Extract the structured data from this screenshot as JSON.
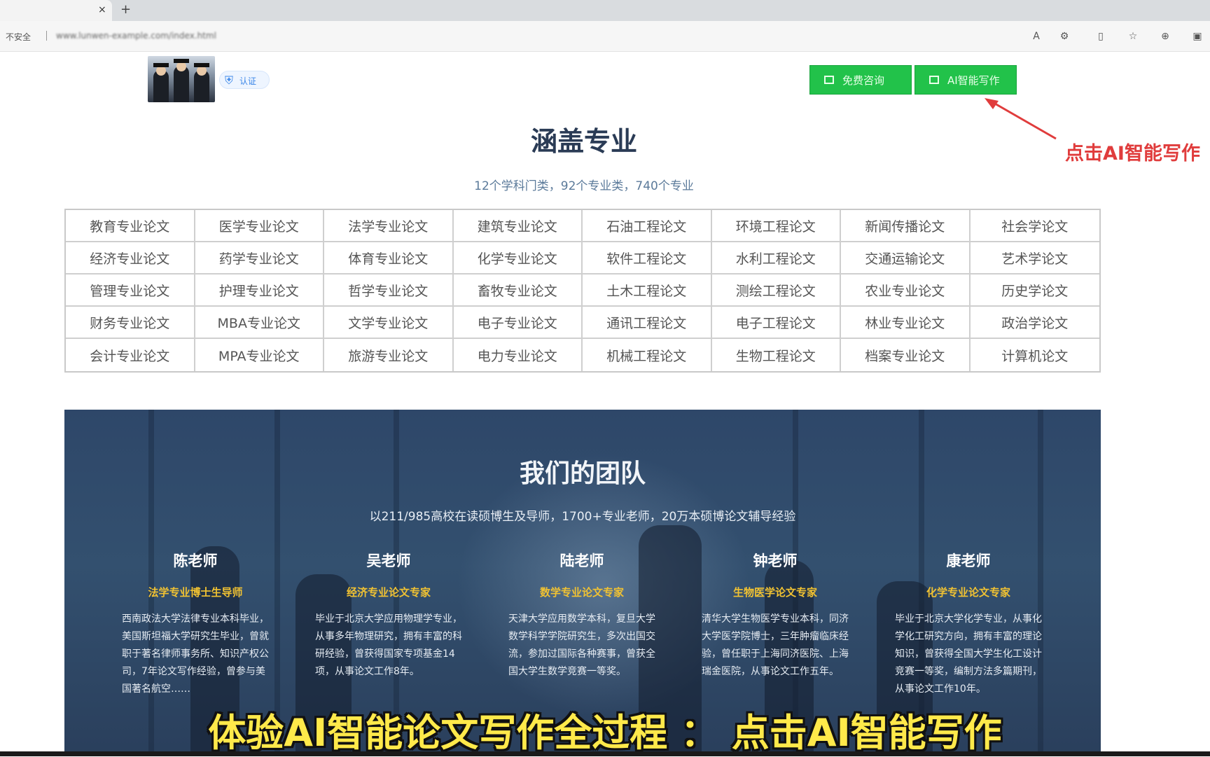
{
  "browser": {
    "tab_close": "×",
    "tab_new": "+",
    "secure_label": "不安全",
    "url": "www.lunwen-example.com/index.html"
  },
  "header": {
    "badge_text": "认证",
    "btn_free": "免费咨询",
    "btn_ai": "AI智能写作"
  },
  "annotation": {
    "text": "点击AI智能写作",
    "color": "#e03c3c"
  },
  "majors": {
    "title": "涵盖专业",
    "subtitle": "12个学科门类，92个专业类，740个专业",
    "items": [
      "教育专业论文",
      "医学专业论文",
      "法学专业论文",
      "建筑专业论文",
      "石油工程论文",
      "环境工程论文",
      "新闻传播论文",
      "社会学论文",
      "经济专业论文",
      "药学专业论文",
      "体育专业论文",
      "化学专业论文",
      "软件工程论文",
      "水利工程论文",
      "交通运输论文",
      "艺术学论文",
      "管理专业论文",
      "护理专业论文",
      "哲学专业论文",
      "畜牧专业论文",
      "土木工程论文",
      "测绘工程论文",
      "农业专业论文",
      "历史学论文",
      "财务专业论文",
      "MBA专业论文",
      "文学专业论文",
      "电子专业论文",
      "通讯工程论文",
      "电子工程论文",
      "林业专业论文",
      "政治学论文",
      "会计专业论文",
      "MPA专业论文",
      "旅游专业论文",
      "电力专业论文",
      "机械工程论文",
      "生物工程论文",
      "档案专业论文",
      "计算机论文"
    ]
  },
  "team": {
    "title": "我们的团队",
    "subtitle": "以211/985高校在读硕博生及导师，1700+专业老师，20万本硕博论文辅导经验",
    "members": [
      {
        "name": "陈老师",
        "role": "法学专业博士生导师",
        "desc": "西南政法大学法律专业本科毕业，美国斯坦福大学研究生毕业，曾就职于著名律师事务所、知识产权公司，7年论文写作经验，曾参与美国著名航空……"
      },
      {
        "name": "吴老师",
        "role": "经济专业论文专家",
        "desc": "毕业于北京大学应用物理学专业，从事多年物理研究，拥有丰富的科研经验，曾获得国家专项基金14项，从事论文工作8年。"
      },
      {
        "name": "陆老师",
        "role": "数学专业论文专家",
        "desc": "天津大学应用数学本科，复旦大学数学科学学院研究生，多次出国交流，参加过国际各种赛事，曾获全国大学生数学竞赛一等奖。"
      },
      {
        "name": "钟老师",
        "role": "生物医学论文专家",
        "desc": "清华大学生物医学专业本科，同济大学医学院博士，三年肿瘤临床经验，曾任职于上海同济医院、上海瑞金医院，从事论文工作五年。"
      },
      {
        "name": "康老师",
        "role": "化学专业论文专家",
        "desc": "毕业于北京大学化学专业，从事化学化工研究方向，拥有丰富的理论知识，曾获得全国大学生化工设计竞赛一等奖，编制方法多篇期刊，从事论文工作10年。"
      }
    ]
  },
  "caption": "体验AI智能论文写作全过程 ： 点击AI智能写作"
}
